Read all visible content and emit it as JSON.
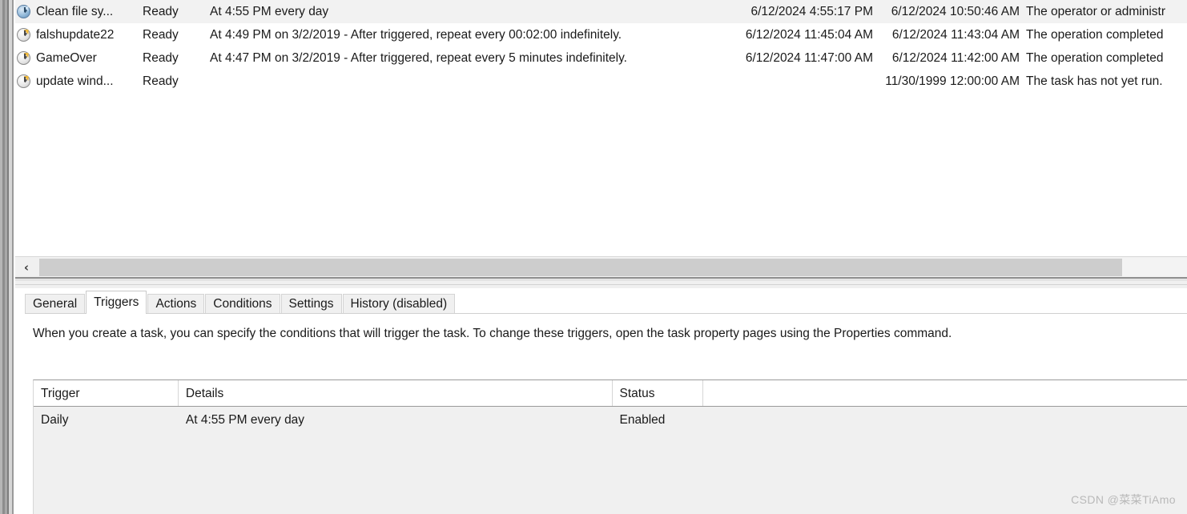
{
  "task_list": {
    "rows": [
      {
        "icon": "clock-icon-blue",
        "name": "Clean file sy...",
        "status": "Ready",
        "triggers": "At 4:55 PM every day",
        "next_run_time": "6/12/2024 4:55:17 PM",
        "last_run_time": "6/12/2024 10:50:46 AM",
        "last_run_result": "The operator or administr",
        "selected": true
      },
      {
        "icon": "clock-icon",
        "name": "falshupdate22",
        "status": "Ready",
        "triggers": "At 4:49 PM on 3/2/2019 - After triggered, repeat every 00:02:00 indefinitely.",
        "next_run_time": "6/12/2024 11:45:04 AM",
        "last_run_time": "6/12/2024 11:43:04 AM",
        "last_run_result": "The operation completed",
        "selected": false
      },
      {
        "icon": "clock-icon",
        "name": "GameOver",
        "status": "Ready",
        "triggers": "At 4:47 PM on 3/2/2019 - After triggered, repeat every 5 minutes indefinitely.",
        "next_run_time": "6/12/2024 11:47:00 AM",
        "last_run_time": "6/12/2024 11:42:00 AM",
        "last_run_result": "The operation completed",
        "selected": false
      },
      {
        "icon": "clock-icon",
        "name": "update wind...",
        "status": "Ready",
        "triggers": "",
        "next_run_time": "",
        "last_run_time": "11/30/1999 12:00:00 AM",
        "last_run_result": "The task has not yet run.",
        "selected": false
      }
    ]
  },
  "horizontal_scrollbar": {
    "left_arrow": "‹"
  },
  "detail_pane": {
    "tabs": [
      {
        "label": "General",
        "active": false
      },
      {
        "label": "Triggers",
        "active": true
      },
      {
        "label": "Actions",
        "active": false
      },
      {
        "label": "Conditions",
        "active": false
      },
      {
        "label": "Settings",
        "active": false
      },
      {
        "label": "History (disabled)",
        "active": false
      }
    ],
    "description": "When you create a task, you can specify the conditions that will trigger the task.  To change these triggers, open the task property pages using the Properties command.",
    "grid": {
      "headers": [
        "Trigger",
        "Details",
        "Status",
        ""
      ],
      "rows": [
        {
          "trigger": "Daily",
          "details": "At 4:55 PM every day",
          "status": "Enabled",
          "extra": ""
        }
      ]
    }
  },
  "watermark": {
    "text": "CSDN @菜菜TiAmo"
  },
  "colors": {
    "selected_row": "#f2f2f2",
    "pane_bg": "#ffffff",
    "chrome": "#f0f0f0",
    "grid_row": "#f0f0f0",
    "scroll_thumb": "#cdcdcd"
  }
}
